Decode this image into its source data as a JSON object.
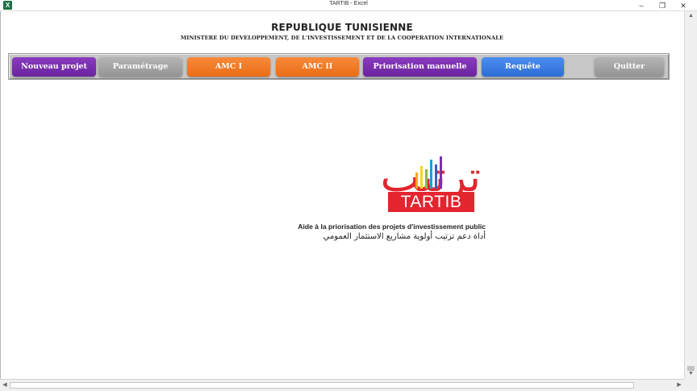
{
  "window": {
    "app_icon": "X",
    "title": "TARTIB - Excel",
    "minimize": "–",
    "maximize": "❐",
    "close": "✕"
  },
  "header": {
    "title": "REPUBLIQUE TUNISIENNE",
    "subtitle": "MINISTERE DU DEVELOPPEMENT, DE L'INVESTISSEMENT ET DE LA COOPERATION INTERNATIONALE"
  },
  "toolbar": {
    "buttons": [
      {
        "label": "Nouveau projet",
        "color": "#7a2fb0"
      },
      {
        "label": "Paramétrage",
        "color": "#a3a3a3"
      },
      {
        "label": "AMC I",
        "color": "#f27b26"
      },
      {
        "label": "AMC II",
        "color": "#f27b26"
      },
      {
        "label": "Priorisation manuelle",
        "color": "#7a2fb0"
      },
      {
        "label": "Requête",
        "color": "#3a7de3"
      },
      {
        "label": "Quitter",
        "color": "#a3a3a3"
      }
    ]
  },
  "logo": {
    "arabic_name": "ترتيب",
    "latin_name": "TARTIB",
    "tagline_fr": "Aide à la priorisation des projets d'investissement public",
    "tagline_ar": "أداة دعم ترتيب أولوية مشاريع الاستثمار العمومي",
    "brand_color": "#e3252f",
    "bar_colors": [
      "#f5a623",
      "#f5d423",
      "#7ac143",
      "#1a9fd8",
      "#3a5fc0",
      "#7a2fb0"
    ]
  },
  "scrollbars": {
    "up_icon": "arrow-up-icon",
    "down_icon": "arrow-down-icon",
    "left_icon": "arrow-left-icon",
    "right_icon": "arrow-right-icon"
  }
}
